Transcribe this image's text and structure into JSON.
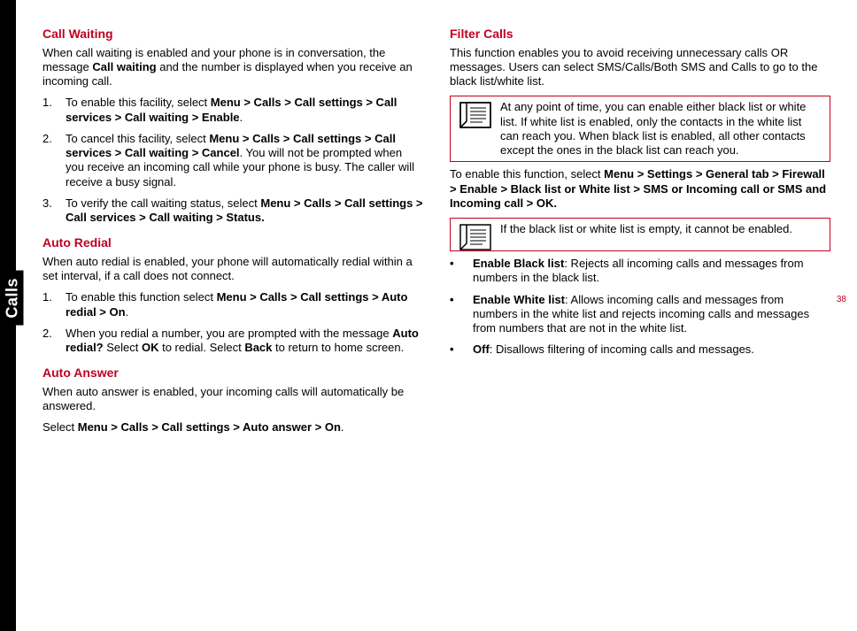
{
  "side_label": "Calls",
  "page_number": "38",
  "left": {
    "s1": {
      "heading": "Call Waiting",
      "p1a": "When call waiting is enabled and your phone is in conversation, the message ",
      "p1b": "Call waiting",
      "p1c": " and the number is displayed when you receive an incoming call.",
      "li1a": "To enable this facility, select ",
      "li1b": "Menu > Calls > Call settings > Call services > Call waiting > Enable",
      "li1c": ".",
      "li2a": "To cancel this facility, select ",
      "li2b": "Menu > Calls > Call settings > Call services > Call waiting > Cancel",
      "li2c": ". You will not be prompted when you receive an incoming call while your phone is busy. The caller will receive a busy signal.",
      "li3a": "To verify the call waiting status, select ",
      "li3b": "Menu > Calls > Call settings > Call services > Call waiting > Status."
    },
    "s2": {
      "heading": "Auto Redial",
      "p1": "When auto redial is enabled, your phone will automatically redial within a set interval, if a call does not connect.",
      "li1a": "To enable this function select ",
      "li1b": "Menu > Calls > Call settings > Auto redial > On",
      "li1c": ".",
      "li2a": "When you redial a number, you are prompted with the message ",
      "li2b": "Auto redial?",
      "li2c": " Select ",
      "li2d": "OK",
      "li2e": " to redial. Select ",
      "li2f": "Back",
      "li2g": " to return to home screen."
    },
    "s3": {
      "heading": "Auto Answer",
      "p1": "When auto answer is enabled, your incoming calls will automatically be answered.",
      "p2a": "Select ",
      "p2b": "Menu > Calls > Call settings > Auto answer > On",
      "p2c": "."
    }
  },
  "right": {
    "s1": {
      "heading": "Filter Calls",
      "p1": "This function enables you to avoid receiving unnecessary calls OR messages. Users can select SMS/Calls/Both SMS and Calls to go to the black list/white list.",
      "note1": "At any point of time, you can enable either black list or white list. If white list is enabled, only the contacts in the white list can reach you. When black list is enabled, all other contacts except the ones in the black list can reach you.",
      "p2a": "To enable this function, select ",
      "p2b": "Menu > Settings > General tab > Firewall > Enable > Black list or White list > SMS or Incoming call or SMS and Incoming call > OK.",
      "note2": "If the black list or white list is empty, it cannot be enabled.",
      "li1a": "Enable Black list",
      "li1b": ": Rejects all incoming calls and messages from numbers in the black list.",
      "li2a": "Enable White list",
      "li2b": ": Allows incoming calls and messages from numbers in the white list and rejects incoming calls and messages from numbers that are not in the white list.",
      "li3a": "Off",
      "li3b": ": Disallows filtering of incoming calls and messages."
    }
  }
}
